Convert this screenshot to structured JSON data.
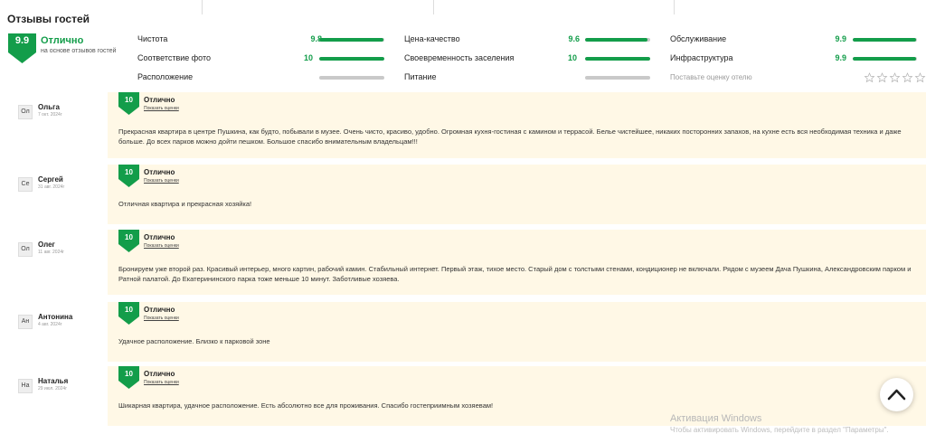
{
  "section_title": "Отзывы гостей",
  "overall": {
    "score": "9.9",
    "label": "Отлично",
    "subtitle": "на основе отзывов гостей",
    "color": "#139d4a"
  },
  "categories": [
    {
      "name": "Чистота",
      "score": "9.8",
      "fraction": 0.98
    },
    {
      "name": "Цена-качество",
      "score": "9.6",
      "fraction": 0.96
    },
    {
      "name": "Обслуживание",
      "score": "9.9",
      "fraction": 0.99
    },
    {
      "name": "Соответствие фото",
      "score": "10",
      "fraction": 1.0
    },
    {
      "name": "Своевременность заселения",
      "score": "10",
      "fraction": 1.0
    },
    {
      "name": "Инфраструктура",
      "score": "9.9",
      "fraction": 0.99
    },
    {
      "name": "Расположение",
      "score": "",
      "fraction": 0
    },
    {
      "name": "Питание",
      "score": "",
      "fraction": 0
    }
  ],
  "rate_hint": "Поставьте оценку отелю",
  "stars_count": 5,
  "reviews": [
    {
      "initials": "Ол",
      "name": "Ольга",
      "date": "7 окт. 2024г",
      "score": "10",
      "label": "Отлично",
      "link": "Показать оценки",
      "text": "Прекрасная квартира в центре Пушкина, как будто, побывали в музее. Очень чисто, красиво, удобно. Огромная кухня-гостиная с камином и террасой. Белье чистейшее, никаких посторонних запахов, на кухне есть вся необходимая техника и даже больше. До всех парков можно дойти пешком. Большое спасибо внимательным владельцам!!!"
    },
    {
      "initials": "Се",
      "name": "Сергей",
      "date": "31 авг. 2024г",
      "score": "10",
      "label": "Отлично",
      "link": "Показать оценки",
      "text": "Отличная квартира и прекрасная хозяйка!"
    },
    {
      "initials": "Ол",
      "name": "Олег",
      "date": "11 авг. 2024г",
      "score": "10",
      "label": "Отлично",
      "link": "Показать оценки",
      "text": "Бронируем уже второй раз. Красивый интерьер, много картин, рабочий камин. Стабильный интернет. Первый этаж, тихое место. Старый дом с толстыми стенами, кондиционер не включали. Рядом с музеем Дача Пушкина, Александровским парком и Ратной палатой. До Екатерининского парка тоже меньше 10 минут. Заботливые хозяева."
    },
    {
      "initials": "Ан",
      "name": "Антонина",
      "date": "4 авг. 2024г",
      "score": "10",
      "label": "Отлично",
      "link": "Показать оценки",
      "text": "Удачное расположение. Близко к парковой зоне"
    },
    {
      "initials": "На",
      "name": "Наталья",
      "date": "29 июл. 2024г",
      "score": "10",
      "label": "Отлично",
      "link": "Показать оценки",
      "text": "Шикарная квартира, удачное расположение. Есть абсолютно все для проживания. Спасибо гостеприимным хозяевам!"
    }
  ],
  "watermark": {
    "title": "Активация Windows",
    "subtitle": "Чтобы активировать Windows, перейдите в раздел \"Параметры\"."
  }
}
